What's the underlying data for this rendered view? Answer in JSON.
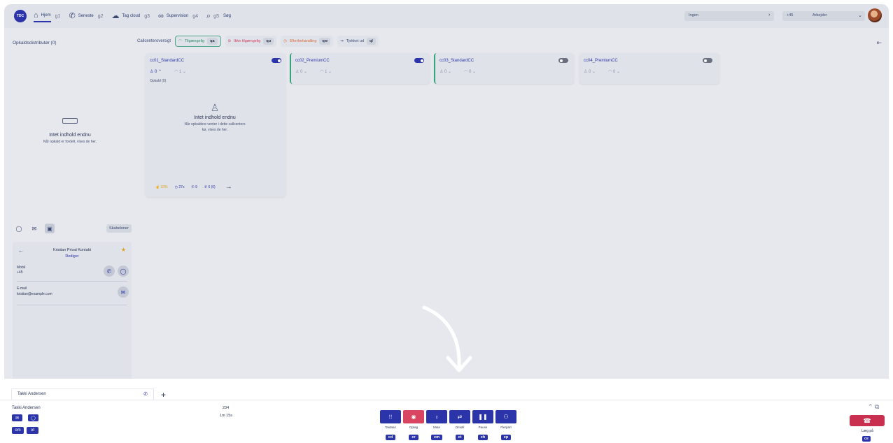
{
  "brand": {
    "logo": "TDC",
    "accent": "#2b34a8"
  },
  "nav": [
    {
      "label": "Hjem",
      "key": "g1",
      "icon": "home-icon"
    },
    {
      "label": "Seneste",
      "key": "g2",
      "icon": "phone-icon"
    },
    {
      "label": "Tag cloud",
      "key": "g3",
      "icon": "cloud-icon"
    },
    {
      "label": "Supervision",
      "key": "g4",
      "icon": "glasses-icon"
    },
    {
      "label": "Søg",
      "key": "g5",
      "icon": "search-icon"
    }
  ],
  "topbar": {
    "select1": "Ingen",
    "phone": "+45",
    "status": "Arbejder"
  },
  "left": {
    "title": "Opkaldsdistributør (0)",
    "empty_title": "Intet indhold endnu",
    "empty_sub": "Når opkald er fordelt, vises de her."
  },
  "overview": {
    "label": "Callcenteroversigt",
    "filters": [
      {
        "label": "Tilgængelig",
        "key": "qa"
      },
      {
        "label": "Ikke tilgængelig",
        "key": "qu"
      },
      {
        "label": "Efterbehandling",
        "key": "qw"
      },
      {
        "label": "Tjekket ud",
        "key": "ql"
      }
    ]
  },
  "callcenters": [
    {
      "name": "cc01_StandardCC",
      "agents": "0",
      "queue": "1",
      "enabled": true
    },
    {
      "name": "cc02_PremiumCC",
      "agents": "0",
      "queue": "1",
      "enabled": true
    },
    {
      "name": "cc03_StandardCC",
      "agents": "0",
      "queue": "0",
      "enabled": false
    },
    {
      "name": "cc04_PremiumCC",
      "agents": "0",
      "queue": "0",
      "enabled": false
    }
  ],
  "cc1_detail": {
    "calls": "Opkald (0)",
    "empty_title": "Intet indhold endnu",
    "empty_sub": "Når opkaldere venter i dette callcenters kø, vises de her.",
    "stats": [
      "33%",
      "27s",
      "9",
      "6 (0)"
    ]
  },
  "tools": {
    "templates": "Skabeloner"
  },
  "contact": {
    "name": "Kristian Privat Kontakt",
    "edit": "Rediger",
    "mobile_label": "Mobil",
    "mobile_value": "+45",
    "email_label": "E-mail",
    "email_value": "kristian@example.com"
  },
  "tab": {
    "label": "Takki Andersen"
  },
  "call": {
    "caller": "Takki Andersen",
    "caller_keys": [
      "om",
      "ot"
    ],
    "number": "234",
    "duration": "1m 15s",
    "controls": [
      {
        "label": "Tastatur",
        "key": "cd",
        "icon": "keypad-icon"
      },
      {
        "label": "Optag",
        "key": "cr",
        "icon": "record-icon"
      },
      {
        "label": "Mute",
        "key": "cm",
        "icon": "mic-icon"
      },
      {
        "label": "Omstil",
        "key": "ct",
        "icon": "transfer-icon"
      },
      {
        "label": "Pause",
        "key": "ch",
        "icon": "pause-icon"
      },
      {
        "label": "Flerpart",
        "key": "cp",
        "icon": "conference-icon"
      }
    ],
    "hangup_label": "Læg på",
    "hangup_key": "ce"
  }
}
